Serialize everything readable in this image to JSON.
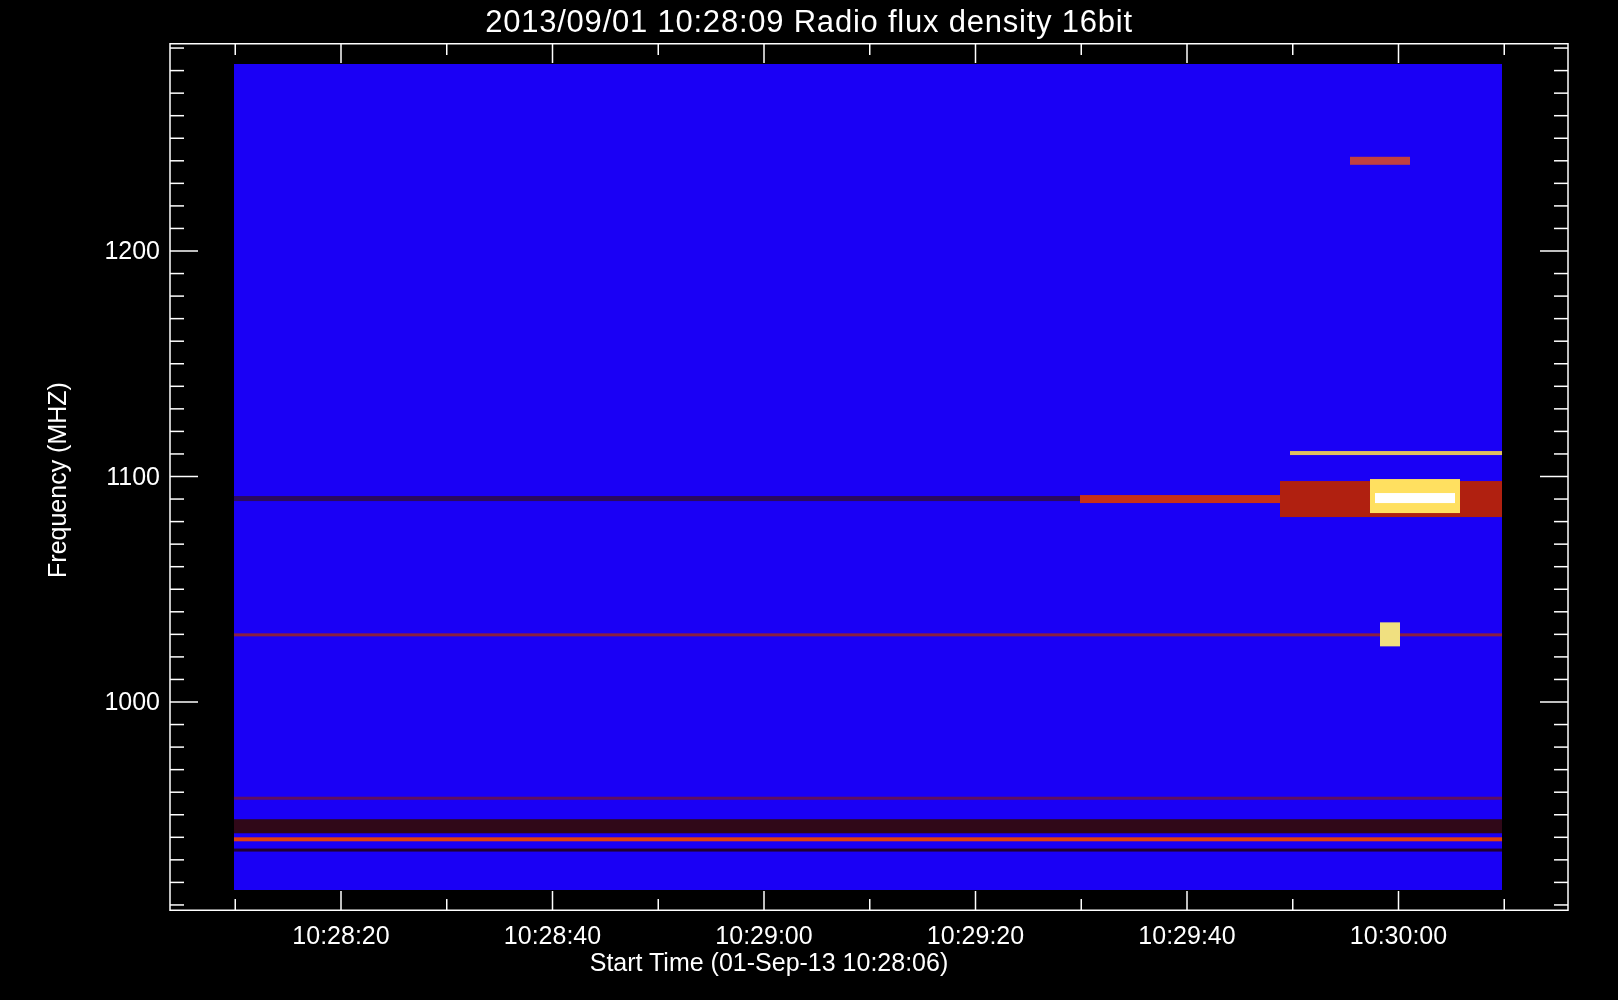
{
  "title": "2013/09/01 10:28:09 Radio flux density 16bit",
  "plot": {
    "ylabel": "Frequency (MHZ)",
    "xlabel": "Start Time (01-Sep-13 10:28:06)",
    "yticks": [
      {
        "label": "1200"
      },
      {
        "label": "1100"
      },
      {
        "label": "1000"
      }
    ],
    "xticks": [
      {
        "label": "10:28:20"
      },
      {
        "label": "10:28:40"
      },
      {
        "label": "10:29:00"
      },
      {
        "label": "10:29:20"
      },
      {
        "label": "10:29:40"
      },
      {
        "label": "10:30:00"
      }
    ]
  }
}
